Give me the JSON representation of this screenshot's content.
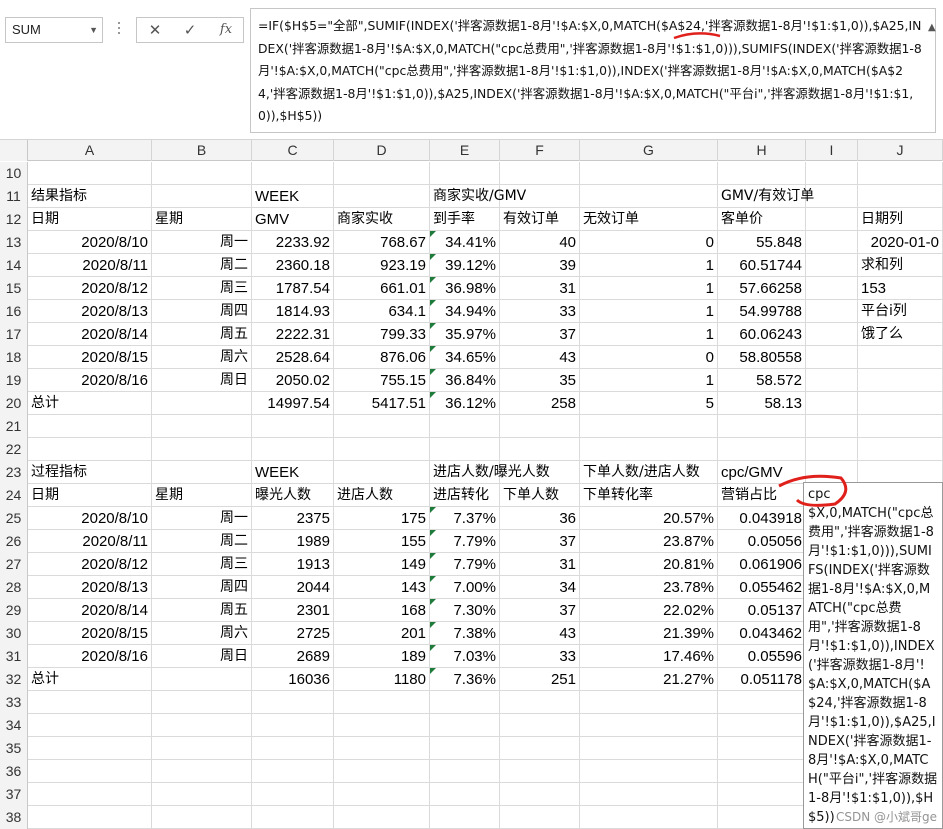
{
  "formula_bar": {
    "name_box": "SUM",
    "formula": "=IF($H$5=\"全部\",SUMIF(INDEX('拌客源数据1-8月'!$A:$X,0,MATCH($A$24,'拌客源数据1-8月'!$1:$1,0)),$A25,INDEX('拌客源数据1-8月'!$A:$X,0,MATCH(\"cpc总费用\",'拌客源数据1-8月'!$1:$1,0))),SUMIFS(INDEX('拌客源数据1-8月'!$A:$X,0,MATCH(\"cpc总费用\",'拌客源数据1-8月'!$1:$1,0)),INDEX('拌客源数据1-8月'!$A:$X,0,MATCH($A$24,'拌客源数据1-8月'!$1:$1,0)),$A25,INDEX('拌客源数据1-8月'!$A:$X,0,MATCH(\"平台i\",'拌客源数据1-8月'!$1:$1,0)),$H$5))",
    "cancel_icon": "close-icon",
    "enter_icon": "check-icon",
    "fx_label": "fx"
  },
  "columns": [
    "A",
    "B",
    "C",
    "D",
    "E",
    "F",
    "G",
    "H",
    "I",
    "J"
  ],
  "rows": [
    {
      "n": "10",
      "cells": {}
    },
    {
      "n": "11",
      "cells": {
        "A": "结果指标",
        "C": "WEEK",
        "E": "商家实收/GMV",
        "H": "GMV/有效订单"
      }
    },
    {
      "n": "12",
      "cells": {
        "A": "日期",
        "B": "星期",
        "C": "GMV",
        "D": "商家实收",
        "E": "到手率",
        "F": "有效订单",
        "G": "无效订单",
        "H": "客单价",
        "J": "日期列"
      }
    },
    {
      "n": "13",
      "cells": {
        "A": "2020/8/10",
        "B": "周一",
        "C": "2233.92",
        "D": "768.67",
        "E": "34.41%",
        "F": "40",
        "G": "0",
        "H": "55.848",
        "J": "2020-01-0"
      }
    },
    {
      "n": "14",
      "cells": {
        "A": "2020/8/11",
        "B": "周二",
        "C": "2360.18",
        "D": "923.19",
        "E": "39.12%",
        "F": "39",
        "G": "1",
        "H": "60.51744",
        "J": "求和列"
      }
    },
    {
      "n": "15",
      "cells": {
        "A": "2020/8/12",
        "B": "周三",
        "C": "1787.54",
        "D": "661.01",
        "E": "36.98%",
        "F": "31",
        "G": "1",
        "H": "57.66258",
        "J": "153"
      }
    },
    {
      "n": "16",
      "cells": {
        "A": "2020/8/13",
        "B": "周四",
        "C": "1814.93",
        "D": "634.1",
        "E": "34.94%",
        "F": "33",
        "G": "1",
        "H": "54.99788",
        "J": "平台i列"
      }
    },
    {
      "n": "17",
      "cells": {
        "A": "2020/8/14",
        "B": "周五",
        "C": "2222.31",
        "D": "799.33",
        "E": "35.97%",
        "F": "37",
        "G": "1",
        "H": "60.06243",
        "J": "饿了么"
      }
    },
    {
      "n": "18",
      "cells": {
        "A": "2020/8/15",
        "B": "周六",
        "C": "2528.64",
        "D": "876.06",
        "E": "34.65%",
        "F": "43",
        "G": "0",
        "H": "58.80558"
      }
    },
    {
      "n": "19",
      "cells": {
        "A": "2020/8/16",
        "B": "周日",
        "C": "2050.02",
        "D": "755.15",
        "E": "36.84%",
        "F": "35",
        "G": "1",
        "H": "58.572"
      }
    },
    {
      "n": "20",
      "cells": {
        "A": "总计",
        "C": "14997.54",
        "D": "5417.51",
        "E": "36.12%",
        "F": "258",
        "G": "5",
        "H": "58.13"
      }
    },
    {
      "n": "21",
      "cells": {}
    },
    {
      "n": "22",
      "cells": {}
    },
    {
      "n": "23",
      "cells": {
        "A": "过程指标",
        "C": "WEEK",
        "E": "进店人数/曝光人数",
        "G": "下单人数/进店人数",
        "H": "cpc/GMV"
      }
    },
    {
      "n": "24",
      "cells": {
        "A": "日期",
        "B": "星期",
        "C": "曝光人数",
        "D": "进店人数",
        "E": "进店转化",
        "F": "下单人数",
        "G": "下单转化率",
        "H": "营销占比"
      }
    },
    {
      "n": "25",
      "cells": {
        "A": "2020/8/10",
        "B": "周一",
        "C": "2375",
        "D": "175",
        "E": "7.37%",
        "F": "36",
        "G": "20.57%",
        "H": "0.043918"
      }
    },
    {
      "n": "26",
      "cells": {
        "A": "2020/8/11",
        "B": "周二",
        "C": "1989",
        "D": "155",
        "E": "7.79%",
        "F": "37",
        "G": "23.87%",
        "H": "0.05056"
      }
    },
    {
      "n": "27",
      "cells": {
        "A": "2020/8/12",
        "B": "周三",
        "C": "1913",
        "D": "149",
        "E": "7.79%",
        "F": "31",
        "G": "20.81%",
        "H": "0.061906"
      }
    },
    {
      "n": "28",
      "cells": {
        "A": "2020/8/13",
        "B": "周四",
        "C": "2044",
        "D": "143",
        "E": "7.00%",
        "F": "34",
        "G": "23.78%",
        "H": "0.055462"
      }
    },
    {
      "n": "29",
      "cells": {
        "A": "2020/8/14",
        "B": "周五",
        "C": "2301",
        "D": "168",
        "E": "7.30%",
        "F": "37",
        "G": "22.02%",
        "H": "0.05137"
      }
    },
    {
      "n": "30",
      "cells": {
        "A": "2020/8/15",
        "B": "周六",
        "C": "2725",
        "D": "201",
        "E": "7.38%",
        "F": "43",
        "G": "21.39%",
        "H": "0.043462"
      }
    },
    {
      "n": "31",
      "cells": {
        "A": "2020/8/16",
        "B": "周日",
        "C": "2689",
        "D": "189",
        "E": "7.03%",
        "F": "33",
        "G": "17.46%",
        "H": "0.05596"
      }
    },
    {
      "n": "32",
      "cells": {
        "A": "总计",
        "C": "16036",
        "D": "1180",
        "E": "7.36%",
        "F": "251",
        "G": "21.27%",
        "H": "0.051178"
      }
    },
    {
      "n": "33",
      "cells": {}
    },
    {
      "n": "34",
      "cells": {}
    },
    {
      "n": "35",
      "cells": {}
    },
    {
      "n": "36",
      "cells": {}
    },
    {
      "n": "37",
      "cells": {}
    },
    {
      "n": "38",
      "cells": {}
    }
  ],
  "comment_popup": {
    "text": "cpc\n$X,0,MATCH(\"cpc总费用\",'拌客源数据1-8月'!$1:$1,0))),SUMIFS(INDEX('拌客源数据1-8月'!$A:$X,0,MATCH(\"cpc总费用\",'拌客源数据1-8月'!$1:$1,0)),INDEX('拌客源数据1-8月'!$A:$X,0,MATCH($A$24,'拌客源数据1-8月'!$1:$1,0)),$A25,INDEX('拌客源数据1-8月'!$A:$X,0,MATCH(\"平台i\",'拌客源数据1-8月'!$1:$1,0)),$H$5))"
  },
  "watermark": "CSDN @小斌哥ge",
  "colors": {
    "accent_red": "#e0201b",
    "triangle_green": "#1e7b3a"
  }
}
